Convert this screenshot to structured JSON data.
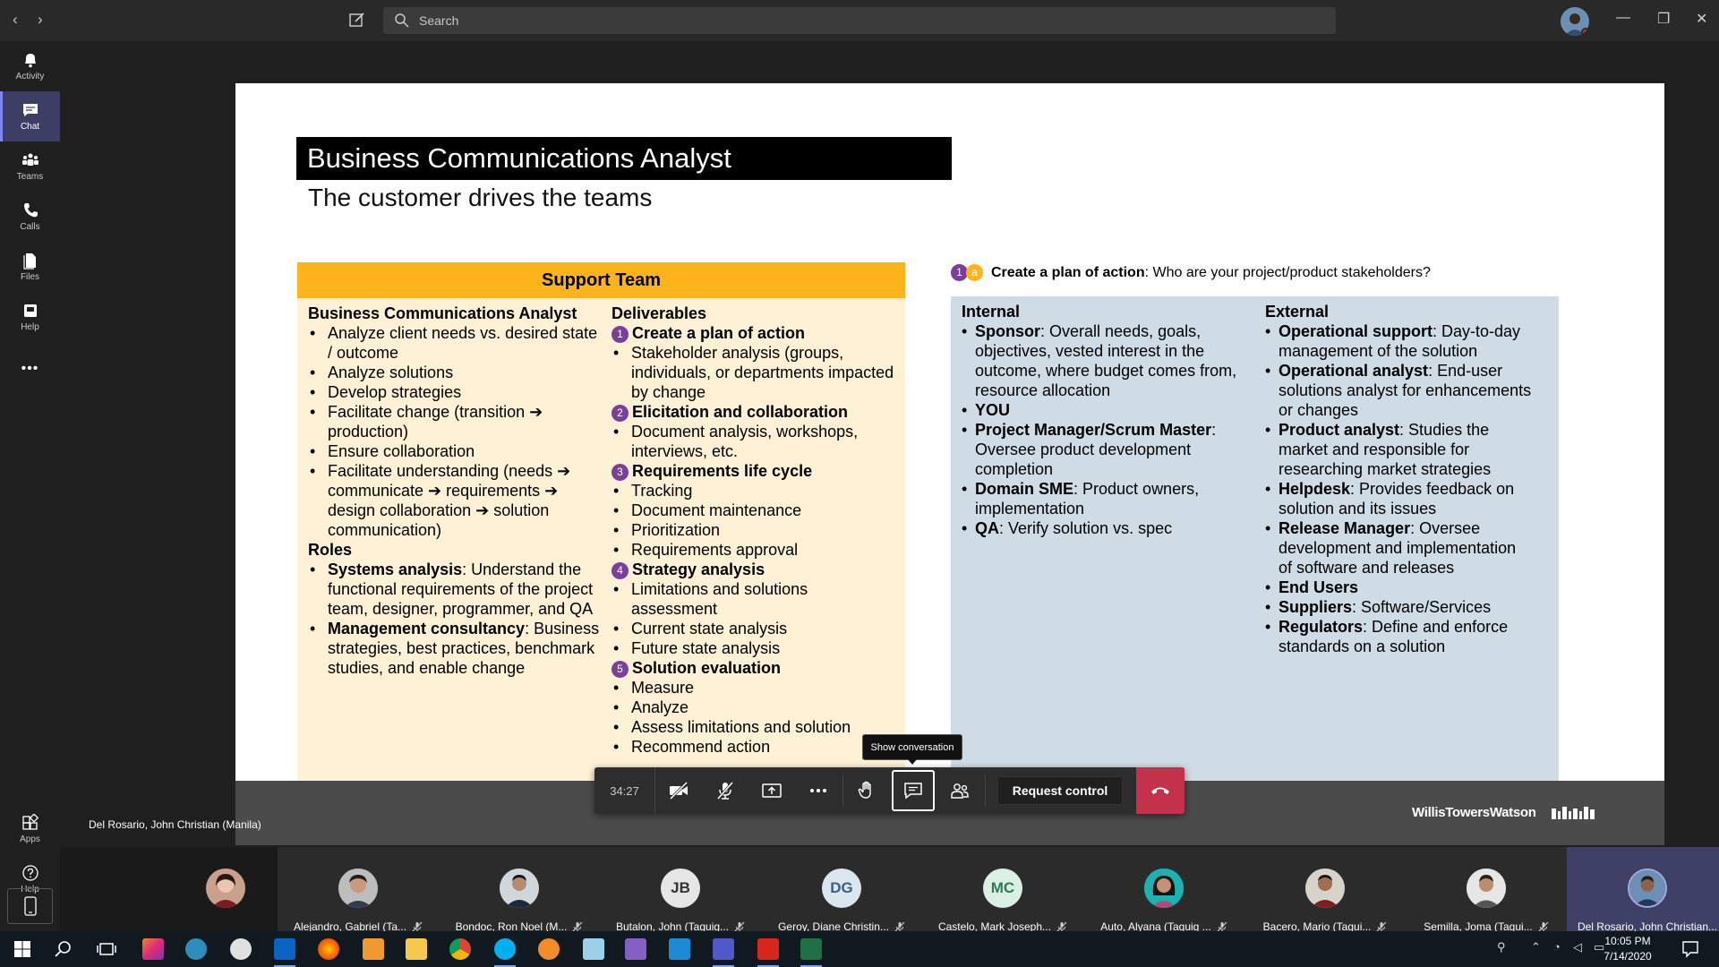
{
  "titlebar": {
    "search_placeholder": "Search",
    "icons": [
      "back-arrow-icon",
      "forward-arrow-icon",
      "compose-icon",
      "search-icon",
      "minimize-icon",
      "restore-icon",
      "close-icon"
    ]
  },
  "rail": {
    "items": [
      {
        "label": "Activity",
        "icon": "bell-icon",
        "active": false
      },
      {
        "label": "Chat",
        "icon": "chat-icon",
        "active": true
      },
      {
        "label": "Teams",
        "icon": "teams-icon",
        "active": false
      },
      {
        "label": "Calls",
        "icon": "phone-icon",
        "active": false
      },
      {
        "label": "Files",
        "icon": "file-icon",
        "active": false
      },
      {
        "label": "Help",
        "icon": "help-book-icon",
        "active": false
      },
      {
        "label": "Apps",
        "icon": "apps-icon",
        "active": false
      },
      {
        "label": "Help",
        "icon": "question-icon",
        "active": false
      }
    ],
    "more": "•••"
  },
  "slide": {
    "title": "Business Communications Analyst",
    "subtitle": "The customer drives the teams",
    "support_header": "Support Team",
    "left_col": {
      "heading": "Business Communications Analyst",
      "items": [
        "Analyze client needs vs. desired state / outcome",
        "Analyze solutions",
        "Develop strategies",
        "Facilitate change (transition ➔ production)",
        "Ensure collaboration",
        "Facilitate understanding (needs ➔ communicate ➔ requirements ➔ design collaboration ➔ solution communication)"
      ],
      "roles_heading": "Roles",
      "roles": [
        {
          "bold": "Systems analysis",
          "text": ": Understand the functional requirements of the project team, designer, programmer, and QA"
        },
        {
          "bold": "Management consultancy",
          "text": ": Business strategies, best practices, benchmark studies, and enable change"
        }
      ]
    },
    "deliverables": {
      "heading": "Deliverables",
      "groups": [
        {
          "num": "1",
          "title": "Create a plan of action",
          "items": [
            "Stakeholder analysis (groups, individuals, or departments impacted by change"
          ]
        },
        {
          "num": "2",
          "title": "Elicitation and collaboration",
          "items": [
            "Document analysis, workshops, interviews, etc."
          ]
        },
        {
          "num": "3",
          "title": "Requirements life cycle",
          "items": [
            "Tracking",
            "Document maintenance",
            "Prioritization",
            "Requirements approval"
          ]
        },
        {
          "num": "4",
          "title": "Strategy analysis",
          "items": [
            "Limitations and solutions assessment",
            "Current state analysis",
            "Future state analysis"
          ]
        },
        {
          "num": "5",
          "title": "Solution evaluation",
          "items": [
            "Measure",
            "Analyze",
            "Assess limitations and solution",
            "Recommend action"
          ]
        }
      ]
    },
    "plan": {
      "n1": "1",
      "na": "a",
      "bold": "Create a plan of action",
      "text": ": Who are your project/product stakeholders?"
    },
    "internal": {
      "heading": "Internal",
      "items": [
        {
          "bold": "Sponsor",
          "text": ": Overall needs, goals, objectives, vested interest in the outcome, where budget comes from, resource allocation"
        },
        {
          "bold": "YOU",
          "text": ""
        },
        {
          "bold": "Project Manager/Scrum Master",
          "text": ": Oversee product development completion"
        },
        {
          "bold": "Domain SME",
          "text": ": Product owners, implementation"
        },
        {
          "bold": "QA",
          "text": ": Verify solution vs. spec"
        }
      ]
    },
    "external": {
      "heading": "External",
      "items": [
        {
          "bold": "Operational support",
          "text": ": Day-to-day management of the solution"
        },
        {
          "bold": "Operational analyst",
          "text": ": End-user solutions analyst for enhancements or changes"
        },
        {
          "bold": "Product analyst",
          "text": ": Studies the market and responsible for researching market strategies"
        },
        {
          "bold": "Helpdesk",
          "text": ": Provides feedback on solution and its issues"
        },
        {
          "bold": "Release Manager",
          "text": ": Oversee development and implementation of software and releases"
        },
        {
          "bold": "End Users",
          "text": ""
        },
        {
          "bold": "Suppliers",
          "text": ": Software/Services"
        },
        {
          "bold": "Regulators",
          "text": ": Define and enforce standards on a solution"
        }
      ]
    },
    "brand": "WillisTowersWatson"
  },
  "stage": {
    "presenter_name": "Del Rosario, John Christian (Manila)"
  },
  "call": {
    "timer": "34:27",
    "tooltip": "Show conversation",
    "request_control": "Request control"
  },
  "participants": [
    {
      "name": "",
      "initials": "",
      "photo": true,
      "color": "#c9a08b"
    },
    {
      "name": "Alejandro, Gabriel (Ta...",
      "initials": "",
      "photo": true,
      "color": "#a07c65"
    },
    {
      "name": "Bondoc, Ron Noel (M...",
      "initials": "",
      "photo": true,
      "color": "#5b6e7d"
    },
    {
      "name": "Butalon, John (Taguig...",
      "initials": "JB",
      "photo": false,
      "color": "#e6e6e6"
    },
    {
      "name": "Geroy, Diane Christin...",
      "initials": "DG",
      "photo": false,
      "color": "#dce6ef"
    },
    {
      "name": "Castelo, Mark Joseph...",
      "initials": "MC",
      "photo": false,
      "color": "#dcefe4"
    },
    {
      "name": "Auto, Alyana (Taguig ...",
      "initials": "",
      "photo": true,
      "color": "#16a3a6"
    },
    {
      "name": "Bacero, Mario (Tagui...",
      "initials": "",
      "photo": true,
      "color": "#8a5c46"
    },
    {
      "name": "Semilla, Joma (Tagui...",
      "initials": "",
      "photo": true,
      "color": "#9e9e9e"
    },
    {
      "name": "Del Rosario, John Christian...",
      "initials": "",
      "photo": true,
      "color": "#4e79a8"
    }
  ],
  "taskbar": {
    "time": "10:05 PM",
    "date": "7/14/2020"
  }
}
